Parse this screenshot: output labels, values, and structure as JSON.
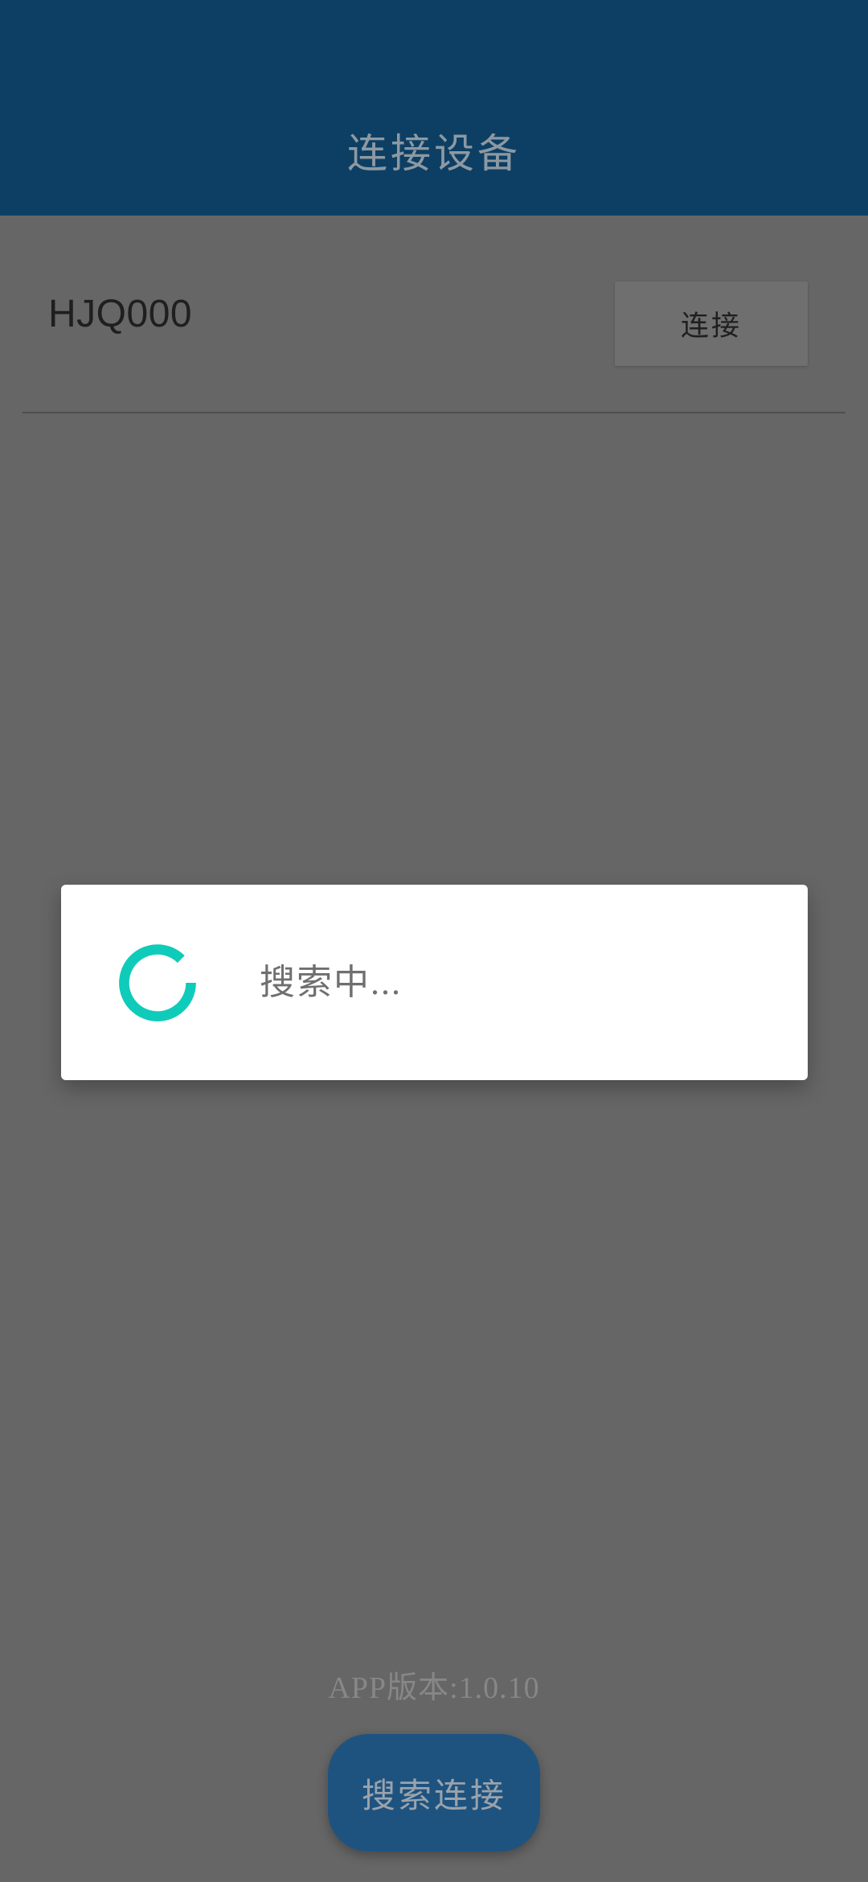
{
  "header": {
    "title": "连接设备",
    "background_color": "#0d3f64",
    "title_color": "#8d99a2"
  },
  "scrim": {
    "background_color": "#666666"
  },
  "device_list": {
    "devices": [
      {
        "name": "HJQ000",
        "connect_label": "连接"
      }
    ]
  },
  "dialog": {
    "message": "搜索中...",
    "spinner_icon": "loading-spinner-icon",
    "spinner_color": "#0fcbba",
    "background_color": "#ffffff"
  },
  "footer": {
    "version_text": "APP版本:1.0.10",
    "search_button_label": "搜索连接",
    "search_button_color": "#1e5380"
  }
}
